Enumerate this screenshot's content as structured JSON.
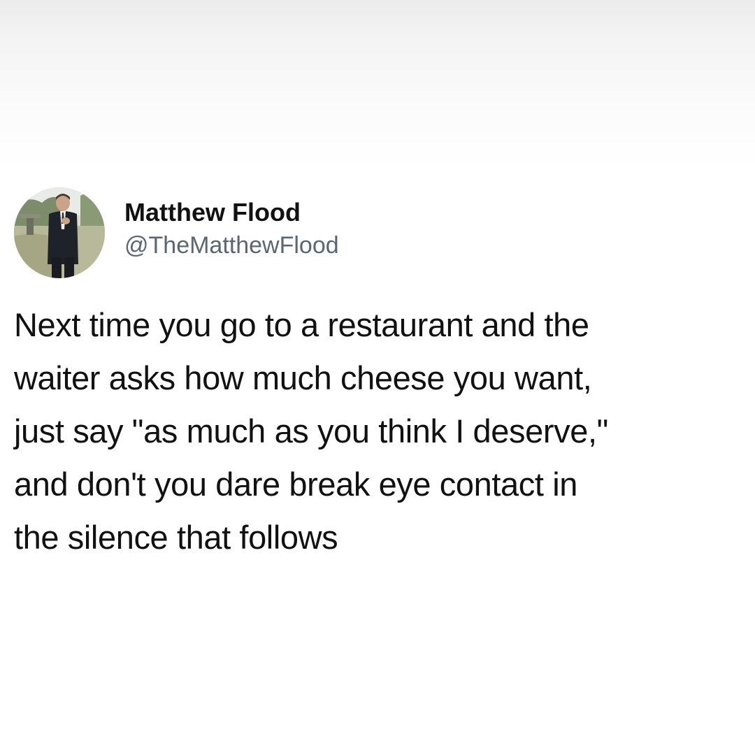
{
  "tweet": {
    "author": {
      "display_name": "Matthew Flood",
      "handle": "@TheMatthewFlood",
      "avatar_icon": "profile-photo"
    },
    "text_lines": [
      "Next time you go to a restaurant and the",
      "waiter asks how much cheese you want,",
      "just say \"as much as you think I deserve,\"",
      "and don't you dare break eye contact in",
      "the silence that follows"
    ]
  }
}
